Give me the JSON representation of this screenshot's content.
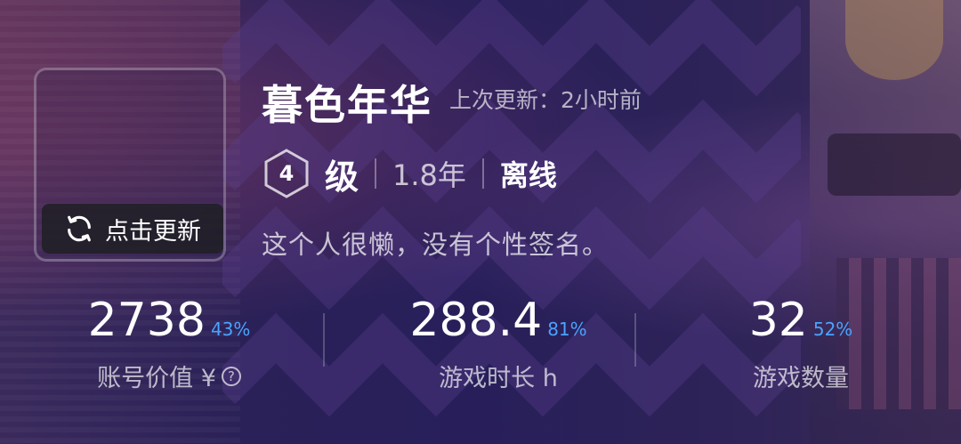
{
  "profile": {
    "name": "暮色年华",
    "updated_label": "上次更新：2小时前",
    "level": "4",
    "level_word": "级",
    "years": "1.8年",
    "status": "离线",
    "signature": "这个人很懒，没有个性签名。",
    "refresh_label": "点击更新"
  },
  "stats": [
    {
      "value": "2738",
      "percent": "43%",
      "label": "账号价值 ¥"
    },
    {
      "value": "288.4",
      "percent": "81%",
      "label": "游戏时长 h"
    },
    {
      "value": "32",
      "percent": "52%",
      "label": "游戏数量"
    }
  ],
  "help_icon_text": "?",
  "colors": {
    "accent": "#4aa3ff",
    "background": "#2b2257"
  }
}
